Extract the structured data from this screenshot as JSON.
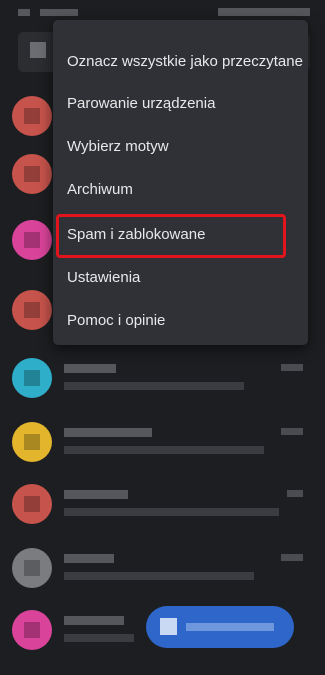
{
  "menu": {
    "items": [
      {
        "label": "Oznacz wszystkie jako przeczytane"
      },
      {
        "label": "Parowanie urządzenia"
      },
      {
        "label": "Wybierz motyw"
      },
      {
        "label": "Archiwum"
      },
      {
        "label": "Spam i zablokowane"
      },
      {
        "label": "Ustawienia"
      },
      {
        "label": "Pomoc i opinie"
      }
    ],
    "highlighted_item": "Spam i zablokowane",
    "highlight_color": "#e3141c"
  },
  "colors": {
    "background": "#1d1e21",
    "menu_background": "#2f3136",
    "menu_text": "#e8e8ea",
    "fab": "#2e66c9"
  },
  "conversations": {
    "avatar_colors": [
      "#c6534c",
      "#c6534c",
      "#d9439a",
      "#c6534c",
      "#2eaec9",
      "#e2b52d",
      "#c6534c",
      "#7a7c80",
      "#d9439a"
    ]
  },
  "icons": {
    "search": "search-icon",
    "fab": "chat-icon"
  }
}
